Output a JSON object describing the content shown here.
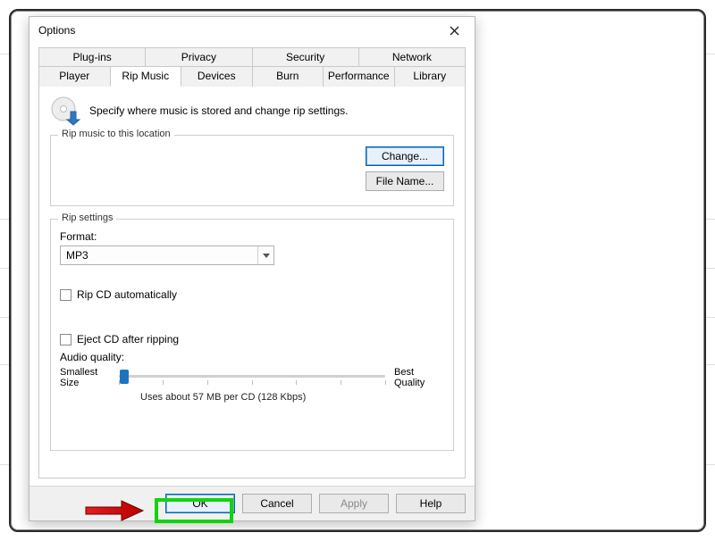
{
  "window": {
    "title": "Options"
  },
  "tabs": {
    "row1": [
      "Plug-ins",
      "Privacy",
      "Security",
      "Network"
    ],
    "row2": [
      "Player",
      "Rip Music",
      "Devices",
      "Burn",
      "Performance",
      "Library"
    ],
    "active": "Rip Music"
  },
  "intro": "Specify where music is stored and change rip settings.",
  "locationGroup": {
    "title": "Rip music to this location",
    "changeBtn": "Change...",
    "fileNameBtn": "File Name..."
  },
  "settingsGroup": {
    "title": "Rip settings",
    "formatLabel": "Format:",
    "formatValue": "MP3",
    "ripAuto": "Rip CD automatically",
    "eject": "Eject CD after ripping",
    "audioQualityLabel": "Audio quality:",
    "sliderLeft": "Smallest\nSize",
    "sliderRight": "Best\nQuality",
    "sliderCaption": "Uses about 57 MB per CD (128 Kbps)"
  },
  "buttons": {
    "ok": "OK",
    "cancel": "Cancel",
    "apply": "Apply",
    "help": "Help"
  }
}
